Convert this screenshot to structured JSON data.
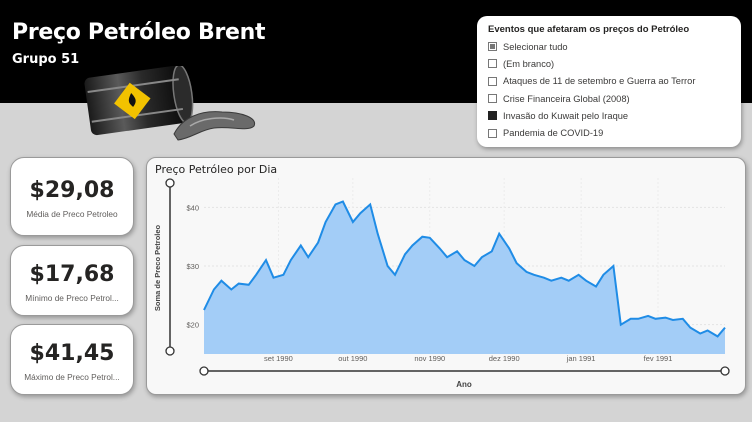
{
  "header": {
    "title": "Preço Petróleo Brent",
    "subtitle": "Grupo 51"
  },
  "slicer": {
    "title": "Eventos que afetaram os preços do Petróleo",
    "items": [
      {
        "label": "Selecionar tudo",
        "state": "partial"
      },
      {
        "label": "(Em branco)",
        "state": "unchecked"
      },
      {
        "label": "Ataques de 11 de setembro e Guerra ao Terror",
        "state": "unchecked"
      },
      {
        "label": "Crise Financeira Global (2008)",
        "state": "unchecked"
      },
      {
        "label": "Invasão do Kuwait pelo Iraque",
        "state": "checked"
      },
      {
        "label": "Pandemia de COVID-19",
        "state": "unchecked"
      }
    ]
  },
  "cards": [
    {
      "value": "$29,08",
      "label": "Média de Preco Petroleo"
    },
    {
      "value": "$17,68",
      "label": "Mínimo de Preco Petrol..."
    },
    {
      "value": "$41,45",
      "label": "Máximo de Preco Petrol..."
    }
  ],
  "colors": {
    "header_bg": "#000000",
    "page_bg": "#d4d4d4",
    "area_fill": "#a3cdf7",
    "line": "#1f8ce6"
  },
  "chart_data": {
    "type": "area",
    "title": "Preço Petróleo por Dia",
    "xlabel": "Ano",
    "ylabel": "Soma de Preco Petroleo",
    "x_ticks": [
      "set 1990",
      "out 1990",
      "nov 1990",
      "dez 1990",
      "jan 1991",
      "fev 1991"
    ],
    "y_ticks": [
      {
        "value": 20,
        "label": "$20"
      },
      {
        "value": 30,
        "label": "$30"
      },
      {
        "value": 40,
        "label": "$40"
      }
    ],
    "ylim": [
      15,
      45
    ],
    "x_range": [
      "1990-08-02",
      "1991-02-28"
    ],
    "grid": true,
    "x": [
      "1990-08-02",
      "1990-08-06",
      "1990-08-09",
      "1990-08-13",
      "1990-08-16",
      "1990-08-20",
      "1990-08-23",
      "1990-08-27",
      "1990-08-30",
      "1990-09-03",
      "1990-09-06",
      "1990-09-10",
      "1990-09-13",
      "1990-09-17",
      "1990-09-20",
      "1990-09-24",
      "1990-09-27",
      "1990-10-01",
      "1990-10-04",
      "1990-10-08",
      "1990-10-11",
      "1990-10-15",
      "1990-10-18",
      "1990-10-22",
      "1990-10-25",
      "1990-10-29",
      "1990-11-01",
      "1990-11-05",
      "1990-11-08",
      "1990-11-12",
      "1990-11-15",
      "1990-11-19",
      "1990-11-22",
      "1990-11-26",
      "1990-11-29",
      "1990-12-03",
      "1990-12-06",
      "1990-12-10",
      "1990-12-13",
      "1990-12-17",
      "1990-12-20",
      "1990-12-24",
      "1990-12-27",
      "1990-12-31",
      "1991-01-03",
      "1991-01-07",
      "1991-01-10",
      "1991-01-14",
      "1991-01-17",
      "1991-01-21",
      "1991-01-24",
      "1991-01-28",
      "1991-01-31",
      "1991-02-04",
      "1991-02-07",
      "1991-02-11",
      "1991-02-14",
      "1991-02-18",
      "1991-02-21",
      "1991-02-25",
      "1991-02-28"
    ],
    "series": [
      {
        "values": [
          22.5,
          26.0,
          27.5,
          26.0,
          27.0,
          26.8,
          28.5,
          31.0,
          28.0,
          28.5,
          31.0,
          33.5,
          31.5,
          34.0,
          37.5,
          40.5,
          41.0,
          37.5,
          39.0,
          40.5,
          35.5,
          30.0,
          28.5,
          32.0,
          33.5,
          35.0,
          34.8,
          33.0,
          31.5,
          32.5,
          31.0,
          30.0,
          31.5,
          32.5,
          35.5,
          33.0,
          30.5,
          29.0,
          28.5,
          28.0,
          27.5,
          28.0,
          27.5,
          28.5,
          27.5,
          26.5,
          28.5,
          30.0,
          20.0,
          21.0,
          21.0,
          21.5,
          21.0,
          21.2,
          20.8,
          21.0,
          19.5,
          18.5,
          19.0,
          18.0,
          19.5
        ]
      }
    ]
  }
}
